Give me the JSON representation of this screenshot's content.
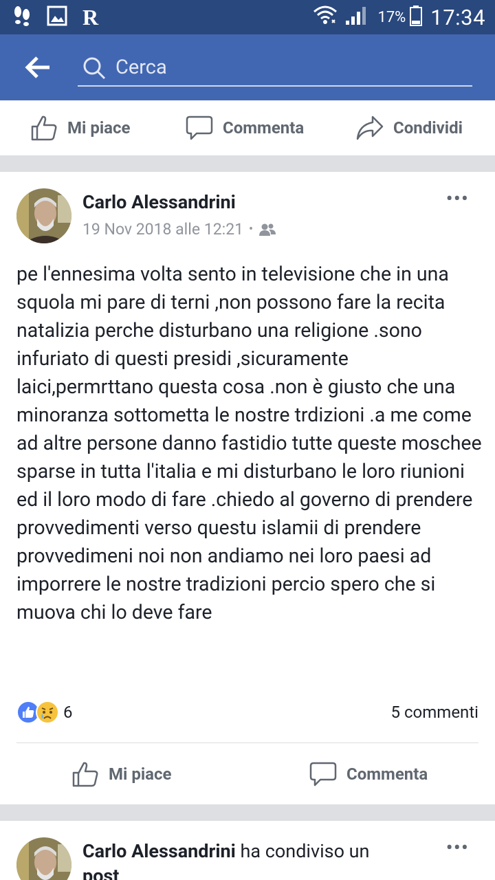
{
  "status_bar": {
    "battery_percent": "17%",
    "time": "17:34",
    "left_icons": [
      "footsteps-icon",
      "image-icon",
      "r-app-icon"
    ],
    "right_icons": [
      "wifi-icon",
      "signal-icon",
      "battery-icon"
    ]
  },
  "search": {
    "placeholder": "Cerca"
  },
  "top_actions": {
    "like": "Mi piace",
    "comment": "Commenta",
    "share": "Condividi"
  },
  "post": {
    "author": "Carlo Alessandrini",
    "date": "19 Nov 2018 alle 12:21",
    "separator": "•",
    "audience_icon": "friends-icon",
    "more": "•••",
    "text": "pe l'ennesima volta sento in televisione che in una squola mi pare di terni ,non possono fare la recita natalizia perche disturbano una religione .sono infuriato di questi presidi ,sicuramente laici,permrttano questa cosa .non è giusto che una minoranza sottometta le nostre trdizioni .a me come ad altre persone danno fastidio tutte queste moschee sparse in tutta l'italia e mi disturbano le loro riunioni ed il loro modo di fare .chiedo al governo di prendere provvedimenti verso questu islamii di prendere provvedimeni noi non andiamo nei loro paesi ad imporrere le nostre tradizioni percio spero che si muova chi lo deve fare",
    "reaction_count": "6",
    "comments": "5 commenti",
    "like_label": "Mi piace",
    "comment_label": "Commenta"
  },
  "post2": {
    "author": "Carlo Alessandrini",
    "action": " ha condiviso un",
    "action_line2": "post",
    "more": "•••"
  },
  "colors": {
    "status_bar": "#29487d",
    "header": "#4267b2",
    "like_blue": "#4267b2",
    "text_gray": "#606770"
  }
}
